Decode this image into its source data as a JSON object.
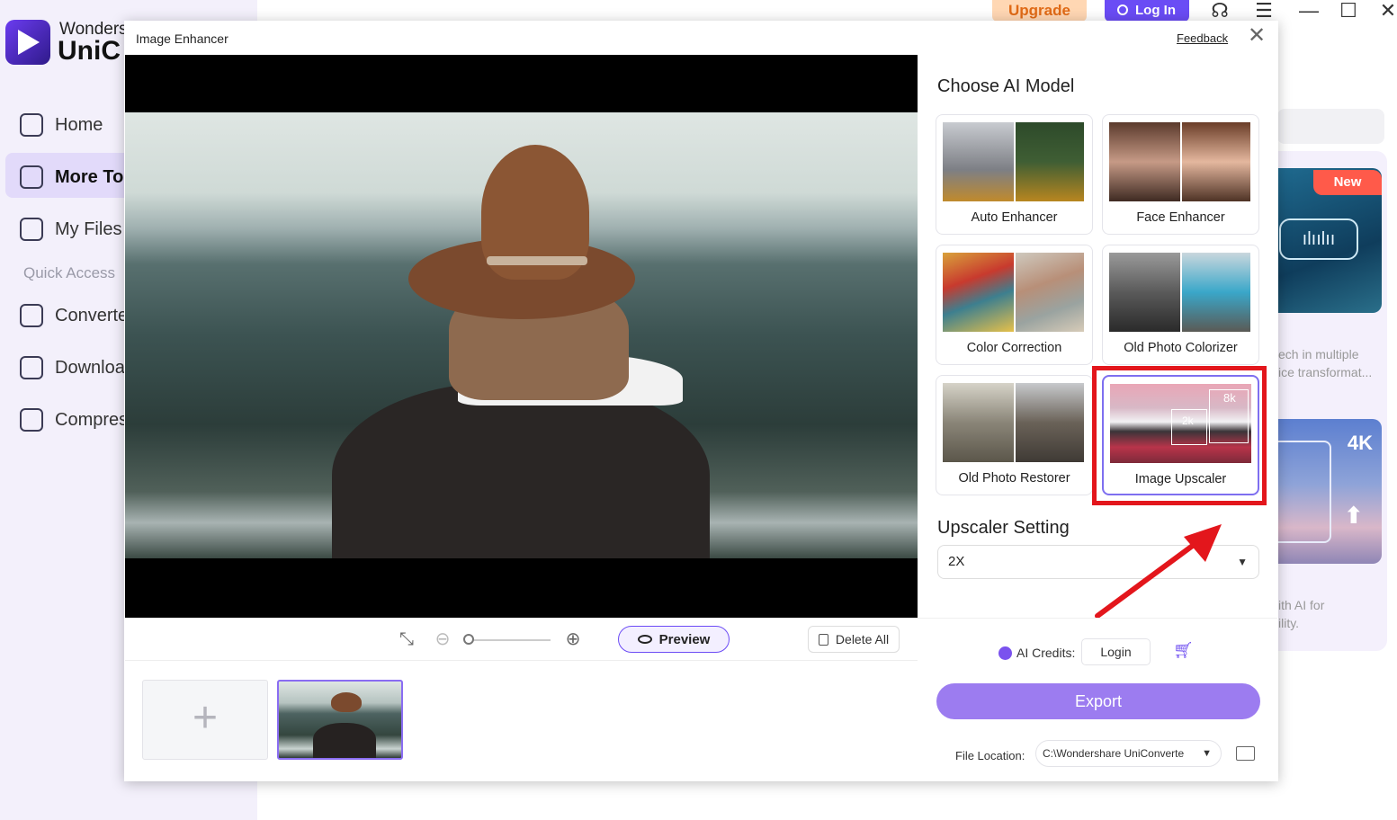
{
  "app": {
    "brand_line1": "Wonders",
    "brand_line2": "UniC",
    "nav": [
      {
        "label": "Home",
        "icon": "home-icon"
      },
      {
        "label": "More To",
        "icon": "toolbox-icon"
      },
      {
        "label": "My Files",
        "icon": "files-icon"
      }
    ],
    "quick_access_label": "Quick Access",
    "quick": [
      {
        "label": "Converte",
        "icon": "converter-icon"
      },
      {
        "label": "Downloa",
        "icon": "download-icon"
      },
      {
        "label": "Compres",
        "icon": "compress-icon"
      }
    ],
    "topbar": {
      "upgrade_label": "Upgrade",
      "login_label": "Log In",
      "icons": [
        "headset-icon",
        "menu-icon",
        "minimize-icon",
        "maximize-icon",
        "close-icon"
      ]
    },
    "background_cards": {
      "new_badge": "New",
      "card1_text_line1": "ech in multiple",
      "card1_text_line2": "ice transformat...",
      "card2_badge": "4K",
      "card2_text_line1": "ith AI for",
      "card2_text_line2": "ility."
    }
  },
  "modal": {
    "title": "Image Enhancer",
    "feedback_label": "Feedback",
    "close_glyph": "✕",
    "toolbar": {
      "preview_label": "Preview",
      "delete_all_label": "Delete All"
    },
    "add_glyph": "+",
    "choose_model_title": "Choose AI Model",
    "models": [
      {
        "label": "Auto Enhancer",
        "selected": false
      },
      {
        "label": "Face Enhancer",
        "selected": false
      },
      {
        "label": "Color Correction",
        "selected": false
      },
      {
        "label": "Old Photo Colorizer",
        "selected": false
      },
      {
        "label": "Old Photo Restorer",
        "selected": false
      },
      {
        "label": "Image Upscaler",
        "selected": true
      }
    ],
    "upscaler_badges": {
      "big": "8k",
      "small": "2k"
    },
    "upscaler_settings_title": "Upscaler Setting",
    "upscaler_value": "2X",
    "ai_credits_label": "AI Credits:",
    "credits_login_label": "Login",
    "export_label": "Export",
    "file_location_label": "File Location:",
    "file_location_value": "C:\\Wondershare UniConverte",
    "accent_color": "#6c4cf5",
    "highlight_color": "#e3161c"
  }
}
